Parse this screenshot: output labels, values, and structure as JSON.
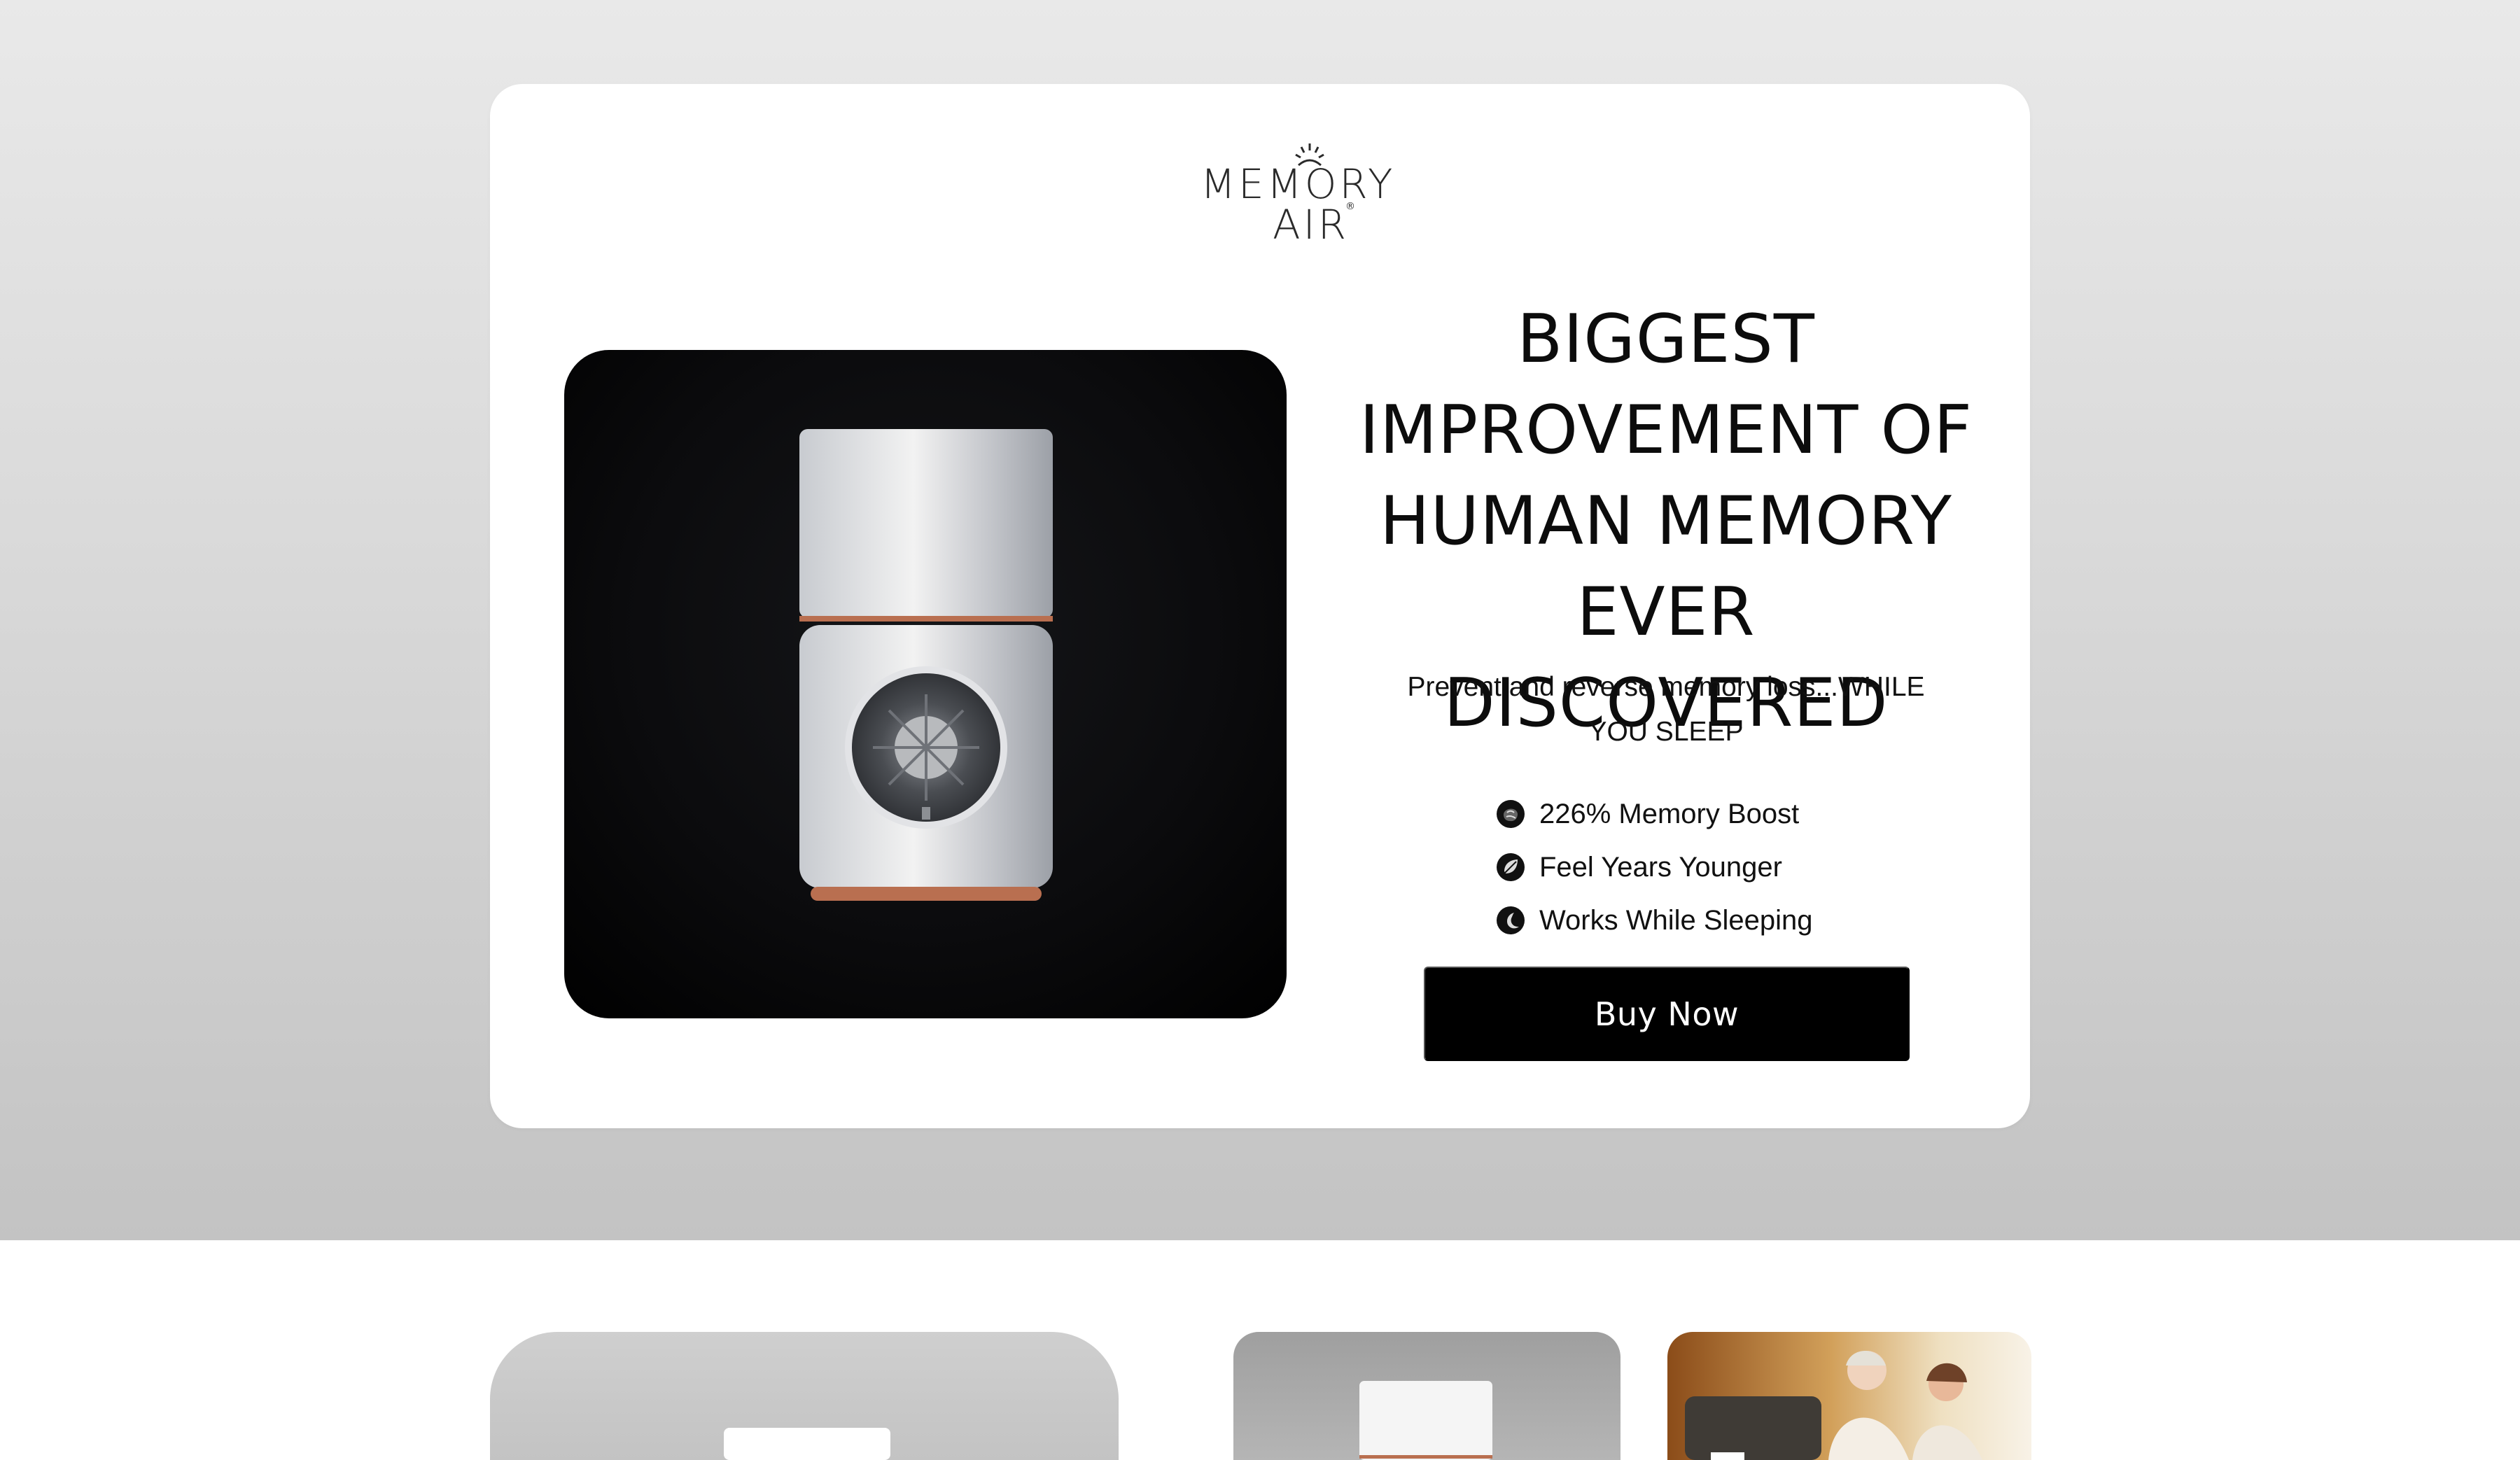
{
  "brand": {
    "name_line1": "MEMORY",
    "name_line2": "AIR",
    "registered": "®"
  },
  "hero": {
    "headline": "BIGGEST IMPROVEMENT OF HUMAN MEMORY EVER DISCOVERED",
    "subheadline": "Prevent and reverse memory loss...WHILE YOU SLEEP",
    "features": [
      {
        "icon": "brain-icon",
        "label": "226% Memory Boost"
      },
      {
        "icon": "leaf-icon",
        "label": "Feel Years Younger"
      },
      {
        "icon": "moon-icon",
        "label": "Works While Sleeping"
      }
    ],
    "cta": "Buy Now"
  },
  "colors": {
    "hero_background_top": "#e9e9e9",
    "hero_background_bottom": "#c3c3c3",
    "card": "#ffffff",
    "button": "#000000",
    "button_text": "#ffffff",
    "accent_copper": "#b96f50"
  },
  "gallery": [
    {
      "icon": "air-purifier-image"
    },
    {
      "icon": "air-purifier-image"
    },
    {
      "icon": "elderly-couple-photo"
    }
  ]
}
